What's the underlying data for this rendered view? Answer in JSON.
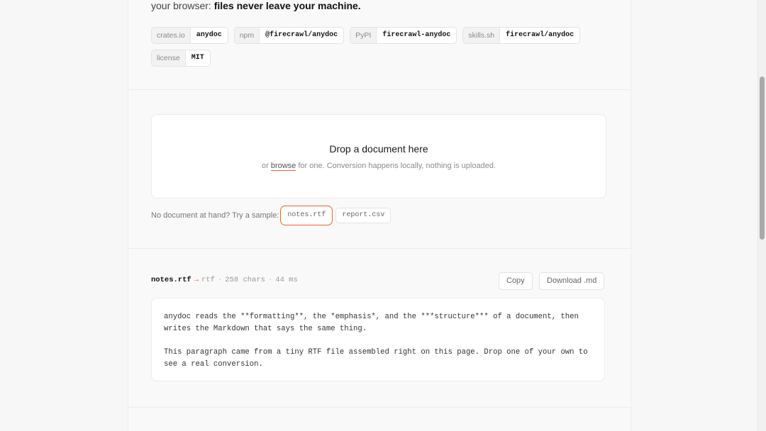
{
  "hero": {
    "tagline_prefix": "your browser: ",
    "tagline_emphasis": "files never leave your machine."
  },
  "badges": [
    {
      "key": "crates.io",
      "value": "anydoc"
    },
    {
      "key": "npm",
      "value": "@firecrawl/anydoc"
    },
    {
      "key": "PyPI",
      "value": "firecrawl-anydoc"
    },
    {
      "key": "skills.sh",
      "value": "firecrawl/anydoc"
    },
    {
      "key": "license",
      "value": "MIT"
    }
  ],
  "dropzone": {
    "title": "Drop a document here",
    "sub_prefix": "or ",
    "browse_label": "browse",
    "sub_suffix": " for one. Conversion happens locally, nothing is uploaded."
  },
  "samples": {
    "prompt": "No document at hand? Try a sample:",
    "items": [
      "notes.rtf",
      "report.csv"
    ],
    "selected": "notes.rtf"
  },
  "result": {
    "filename": "notes.rtf",
    "arrow": "→",
    "format": "rtf",
    "separator": "·",
    "chars": "258 chars",
    "time": "44 ms",
    "copy_label": "Copy",
    "download_label": "Download .md",
    "paragraphs": [
      "anydoc reads the **formatting**, the *emphasis*, and the ***structure*** of a document, then writes the Markdown that says the same thing.",
      "This paragraph came from a tiny RTF file assembled right on this page. Drop one of your own to see a real conversion."
    ]
  },
  "colors": {
    "accent": "#e8662a",
    "page_bg": "#f7f7f7",
    "card_bg": "#ffffff"
  }
}
